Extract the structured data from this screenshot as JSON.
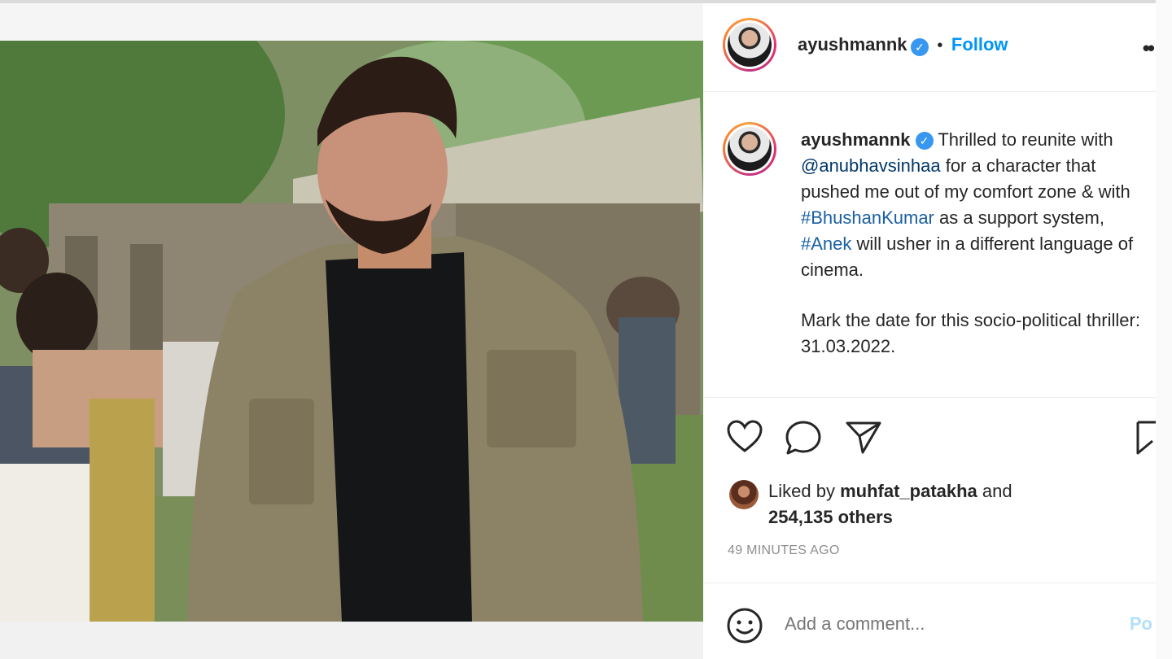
{
  "post": {
    "author": "ayushmannk",
    "follow_label": "Follow",
    "separator": "•",
    "more_label": "••",
    "caption": {
      "username": "ayushmannk",
      "line1_a": "Thrilled to reunite with",
      "mention": "@anubhavsinhaa",
      "line1_b": "for a character that pushed me out of my comfort zone & with",
      "hashtag1": "#BhushanKumar",
      "line1_c": "as a support system,",
      "hashtag2": "#Anek",
      "line1_d": "will usher in a different language of cinema.",
      "para2": "Mark the date for this socio-political thriller: 31.03.2022."
    },
    "actions": {
      "like": "heart-icon",
      "comment": "comment-icon",
      "share": "share-icon",
      "save": "bookmark-icon"
    },
    "likes": {
      "prefix": "Liked by",
      "user": "muhfat_patakha",
      "and": "and",
      "others": "254,135 others"
    },
    "time": "49 MINUTES AGO",
    "comment": {
      "placeholder": "Add a comment...",
      "post_label": "Po"
    }
  },
  "colors": {
    "link": "#0095f6",
    "hashtag": "#1a5fa3",
    "verified": "#3897f0",
    "muted": "#8e8e8e"
  }
}
